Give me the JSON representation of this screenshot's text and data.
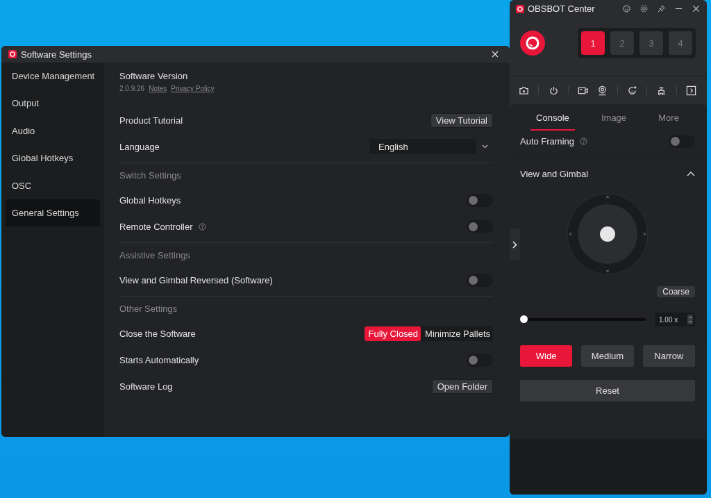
{
  "settings_window": {
    "title": "Software Settings",
    "sidebar": [
      {
        "label": "Device Management",
        "selected": false
      },
      {
        "label": "Output",
        "selected": false
      },
      {
        "label": "Audio",
        "selected": false
      },
      {
        "label": "Global Hotkeys",
        "selected": false
      },
      {
        "label": "OSC",
        "selected": false
      },
      {
        "label": "General Settings",
        "selected": true
      }
    ],
    "rows": [
      {
        "kind": "version",
        "label": "Software Version",
        "version": "2.0.9.26",
        "links": [
          "Notes",
          "Privacy Policy"
        ]
      },
      {
        "kind": "button",
        "label": "Product Tutorial",
        "button": "View Tutorial"
      },
      {
        "kind": "dropdown",
        "label": "Language",
        "value": "English"
      },
      {
        "kind": "header",
        "label": "Switch Settings"
      },
      {
        "kind": "toggle",
        "label": "Global Hotkeys",
        "on": false,
        "help": false
      },
      {
        "kind": "toggle",
        "label": "Remote Controller",
        "on": false,
        "help": true
      },
      {
        "kind": "header",
        "label": "Assistive Settings"
      },
      {
        "kind": "toggle",
        "label": "View and Gimbal Reversed (Software)",
        "on": false,
        "help": false
      },
      {
        "kind": "header",
        "label": "Other Settings"
      },
      {
        "kind": "segmented",
        "label": "Close the Software",
        "options": [
          {
            "label": "Fully Closed",
            "selected": true
          },
          {
            "label": "Minimize Pallets",
            "selected": false
          }
        ]
      },
      {
        "kind": "toggle",
        "label": "Starts Automatically",
        "on": false,
        "help": false
      },
      {
        "kind": "button",
        "label": "Software Log",
        "button": "Open Folder"
      }
    ]
  },
  "center_window": {
    "title": "OBSBOT Center",
    "cameras": [
      {
        "label": "1",
        "selected": true
      },
      {
        "label": "2",
        "selected": false
      },
      {
        "label": "3",
        "selected": false
      },
      {
        "label": "4",
        "selected": false
      }
    ],
    "tabs": [
      {
        "label": "Console",
        "selected": true
      },
      {
        "label": "Image",
        "selected": false
      },
      {
        "label": "More",
        "selected": false
      }
    ],
    "auto_framing": {
      "label": "Auto Framing",
      "on": false
    },
    "gimbal": {
      "title": "View and Gimbal",
      "expanded": true,
      "coarse_button": "Coarse",
      "zoom": {
        "level": 0.0,
        "reading": "1.00 x"
      },
      "fov": [
        {
          "label": "Wide",
          "selected": true
        },
        {
          "label": "Medium",
          "selected": false
        },
        {
          "label": "Narrow",
          "selected": false
        }
      ],
      "reset_button": "Reset"
    }
  }
}
